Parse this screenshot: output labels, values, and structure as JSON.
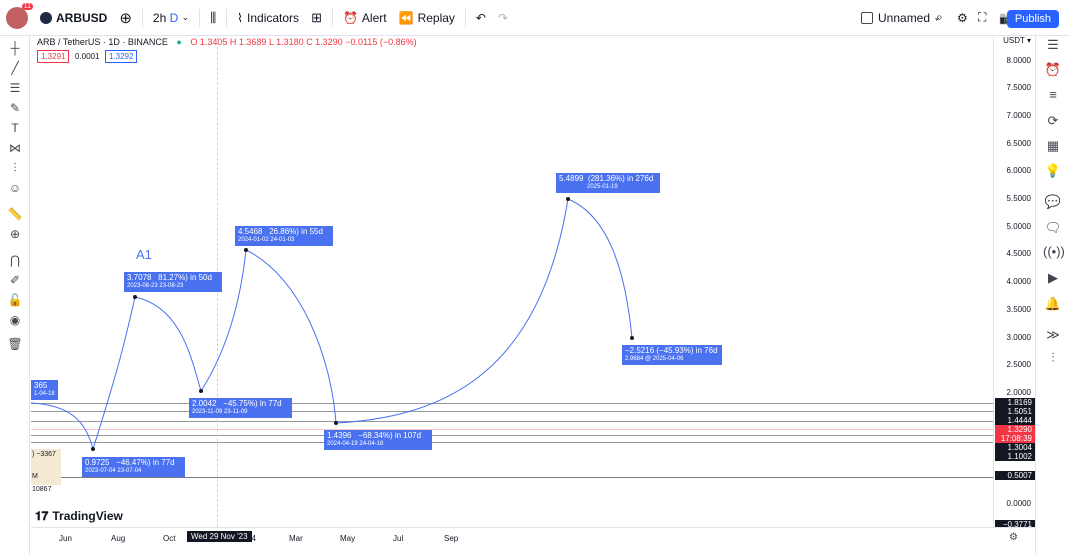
{
  "topbar": {
    "avatar_badge": "11",
    "symbol": "ARBUSD",
    "interval": "2h",
    "interval_mode": "D",
    "indicators": "Indicators",
    "alert": "Alert",
    "replay": "Replay",
    "layout_name": "Unnamed",
    "publish": "Publish"
  },
  "legend": {
    "title": "ARB / TetherUS · 1D · BINANCE",
    "open": "O 1.3405",
    "high": "H 1.3689",
    "low": "L 1.3180",
    "close": "C 1.3290",
    "change": "−0.0115 (−0.86%)",
    "bid": "1.3291",
    "spread": "0.0001",
    "ask": "1.3292"
  },
  "price_axis": {
    "currency": "USDT",
    "ticks": [
      "8.0000",
      "7.5000",
      "7.0000",
      "6.5000",
      "6.0000",
      "5.5000",
      "5.0000",
      "4.5000",
      "4.0000",
      "3.5000",
      "3.0000",
      "2.5000",
      "2.0000",
      "0.0000"
    ],
    "tags": [
      "1.8169",
      "1.5051",
      "1.4444",
      "1.3290",
      "17:08:39",
      "1.3004",
      "1.1002",
      "0.5007",
      "−0.3771"
    ]
  },
  "time_axis": {
    "ticks": [
      "Jun",
      "Aug",
      "Oct",
      "24",
      "Mar",
      "May",
      "Jul",
      "Sep"
    ],
    "cursor_date": "Wed 29 Nov '23"
  },
  "annotations": {
    "label_a1": "A1",
    "m1": {
      "price": "0.9725",
      "change": "−46.47%) in 77d",
      "date": "2023-07-04",
      "date2": "23-07-04"
    },
    "m2": {
      "price": "3.7078",
      "change": "81.27%) in 50d",
      "date": "2023-08-23",
      "date2": "23-08-23"
    },
    "m3": {
      "price": "2.0042",
      "change": "−45.75%) in 77d",
      "date": "2023-11-09",
      "date2": "23-11-09"
    },
    "m4": {
      "price": "4.5468",
      "change": "26.86%) in 55d",
      "date": "2024-01-02",
      "date2": "24-01-03"
    },
    "m5": {
      "price": "1.4396",
      "change": "−68.34%) in 107d",
      "date": "2024-04-19",
      "date2": "24-04-18"
    },
    "m6": {
      "price": "5.4899",
      "change": "(281.36%) in 276d",
      "date": "2025-01-19"
    },
    "m7": {
      "price": "−2.5216 (−45.93%) in 76d",
      "detail": "2.9684 @ 2025-04-06"
    },
    "left_cut1": "365",
    "left_cut1b": "1-04-18",
    "left_cut2": ") −3367",
    "left_cut3": "M",
    "left_cut4": "10867"
  },
  "brand": "TradingView"
}
